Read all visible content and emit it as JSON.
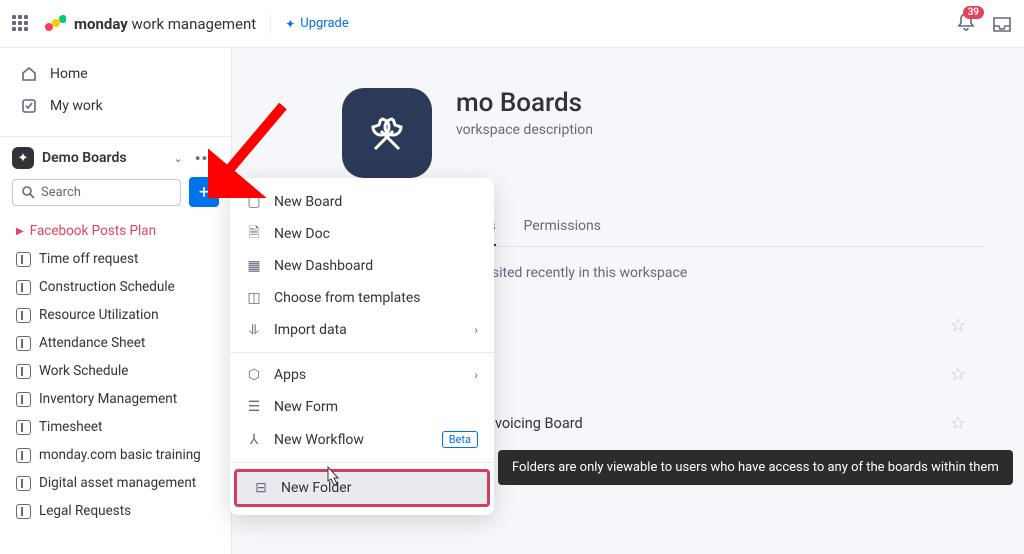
{
  "header": {
    "brand_bold": "monday",
    "brand_rest": "work management",
    "upgrade": "Upgrade",
    "notif_count": "39"
  },
  "nav": {
    "home": "Home",
    "mywork": "My work"
  },
  "workspace": {
    "name": "Demo Boards",
    "search_placeholder": "Search"
  },
  "boards": [
    "Facebook Posts Plan",
    "Time off request",
    "Construction Schedule",
    "Resource Utilization",
    "Attendance Sheet",
    "Work Schedule",
    "Inventory Management",
    "Timesheet",
    "monday.com basic training",
    "Digital asset management",
    "Legal Requests"
  ],
  "main": {
    "title_visible": "mo Boards",
    "desc_visible": "vorkspace description",
    "tab_members": "mbers",
    "tab_permissions": "Permissions",
    "recent_caption": "you visited recently in this workspace",
    "recent_board": "Invoicing Board"
  },
  "dropdown": {
    "new_board": "New Board",
    "new_doc": "New Doc",
    "new_dashboard": "New Dashboard",
    "choose_templates": "Choose from templates",
    "import_data": "Import data",
    "apps": "Apps",
    "new_form": "New Form",
    "new_workflow": "New Workflow",
    "beta": "Beta",
    "new_folder": "New Folder"
  },
  "tooltip": "Folders are only viewable to users who have access to any of the boards within them"
}
